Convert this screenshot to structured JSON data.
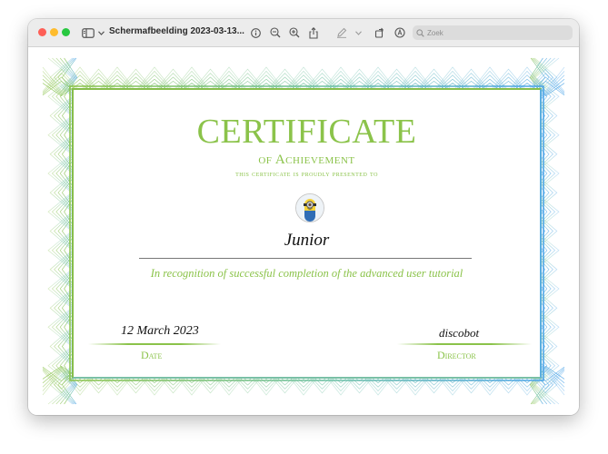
{
  "window": {
    "title": "Schermafbeelding 2023-03-13...",
    "search": {
      "placeholder": "Zoek"
    }
  },
  "icons": {
    "sidebar": "sidebar-icon",
    "chevron": "chevron-down-icon",
    "info": "info-icon",
    "zoom_out": "zoom-out-icon",
    "zoom_in": "zoom-in-icon",
    "share": "share-icon",
    "markup": "pencil-icon",
    "rotate": "rotate-icon",
    "annotate": "annotate-icon",
    "search": "search-icon"
  },
  "certificate": {
    "title": "CERTIFICATE",
    "subtitle": "of Achievement",
    "presented": "this certificate is proudly presented to",
    "recipient": "Junior",
    "recognition": "In recognition of successful completion of the advanced user tutorial",
    "date_value": "12 March 2023",
    "date_label": "Date",
    "director_value": "discobot",
    "director_label": "Director"
  },
  "colors": {
    "accent_green": "#8bc34a",
    "accent_blue": "#5aaee0",
    "traffic_red": "#fe5f57",
    "traffic_yellow": "#febc2e",
    "traffic_green": "#28c840"
  }
}
